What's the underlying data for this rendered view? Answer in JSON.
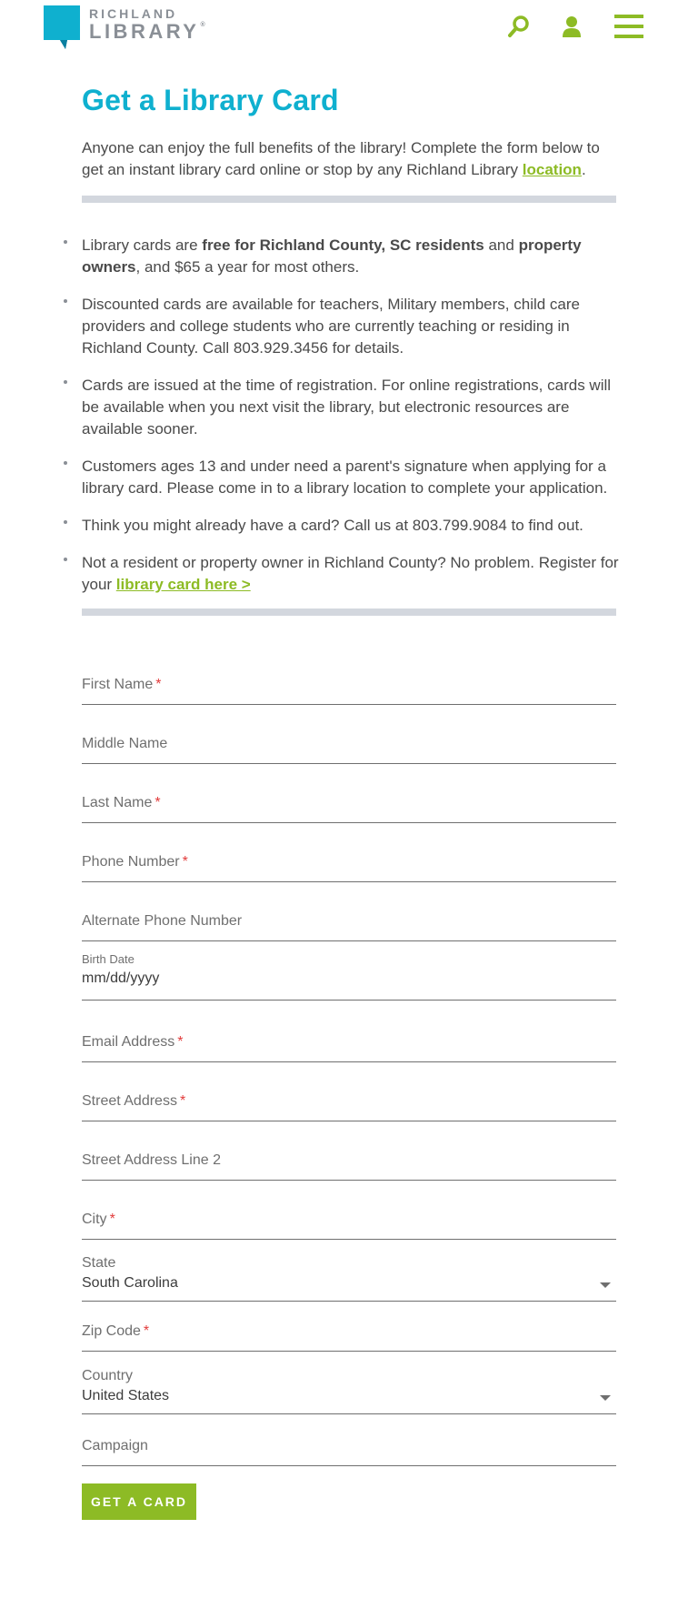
{
  "colors": {
    "brand_blue": "#0fb0cf",
    "accent_green": "#8dbb25",
    "rule_gray": "#d3d7de",
    "required_red": "#e23b3b"
  },
  "header": {
    "logo_top": "RICHLAND",
    "logo_bottom": "LIBRARY",
    "logo_reg": "®",
    "icons": [
      "search-icon",
      "account-icon",
      "menu-icon"
    ]
  },
  "page": {
    "title": "Get a Library Card",
    "intro_text": "Anyone can enjoy the full benefits of the library! Complete the form below to get an instant library card online or stop by any Richland Library ",
    "intro_link": "location",
    "intro_end": "."
  },
  "bullets": {
    "b1_pre": "Library cards are ",
    "b1_bold1": "free for Richland County, SC residents",
    "b1_mid": " and ",
    "b1_bold2": "property owners",
    "b1_post": ", and $65 a year for most others.",
    "b2": "Discounted cards are available for teachers, Military members, child care providers and college students who are currently teaching or residing in Richland County. Call 803.929.3456 for details.",
    "b3": "Cards are issued at the time of registration. For online registrations, cards will be available when you next visit the library, but electronic resources are available sooner.",
    "b4": "Customers ages 13 and under need a parent's signature when applying for a library card. Please come in to a library location to complete your application.",
    "b5": "Think you might already have a card? Call us at 803.799.9084 to find out.",
    "b6_pre": "Not a resident or property owner in Richland County? No problem. Register for your ",
    "b6_link": "library card here >"
  },
  "form": {
    "required_mark": "*",
    "first_name": "First Name",
    "middle_name": "Middle Name",
    "last_name": "Last Name",
    "phone": "Phone Number",
    "alt_phone": "Alternate Phone Number",
    "birth_date_label": "Birth Date",
    "birth_date_placeholder": "mm/dd/yyyy",
    "email": "Email Address",
    "street": "Street Address",
    "street2": "Street Address Line 2",
    "city": "City",
    "state_label": "State",
    "state_value": "South Carolina",
    "zip": "Zip Code",
    "country_label": "Country",
    "country_value": "United States",
    "campaign": "Campaign",
    "submit": "GET A CARD"
  }
}
